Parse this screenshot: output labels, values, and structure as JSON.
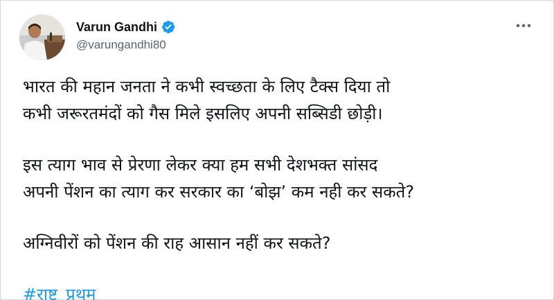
{
  "tweet": {
    "author": {
      "display_name": "Varun Gandhi",
      "handle": "@varungandhi80",
      "verified": true
    },
    "text": {
      "para1_line1": "भारत की महान जनता ने कभी स्वच्छता के लिए टैक्स दिया तो",
      "para1_line2": "कभी जरूरतमंदों को गैस मिले इसलिए अपनी सब्सिडी छोड़ी।",
      "para2_line1": "इस त्याग भाव से प्रेरणा लेकर क्या हम सभी देशभक्त सांसद",
      "para2_line2": "अपनी पेंशन का त्याग कर सरकार का ‘बोझ’ कम नही कर सकते?",
      "para3_line1": "अग्निवीरों को पेंशन की राह आसान नहीं कर सकते?",
      "hashtag": "#राष्ट्र_प्रथम"
    }
  },
  "colors": {
    "text": "#0f1419",
    "secondary": "#536471",
    "accent": "#1d9bf0",
    "border": "#cfd9de"
  },
  "icons": {
    "verified": "verified-badge-icon",
    "more": "more-options-icon"
  }
}
